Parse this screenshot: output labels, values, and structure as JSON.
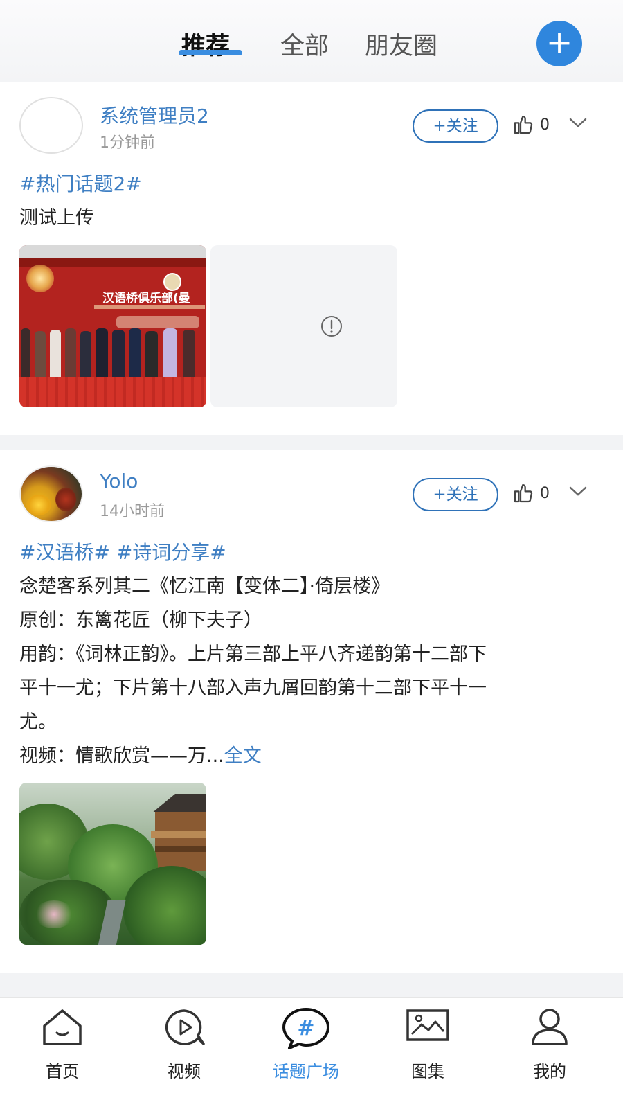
{
  "header": {
    "tabs": [
      {
        "label": "推荐",
        "active": true
      },
      {
        "label": "全部",
        "active": false
      },
      {
        "label": "朋友圈",
        "active": false
      }
    ],
    "add_label": "+"
  },
  "posts": [
    {
      "username": "系统管理员2",
      "time": "1分钟前",
      "follow_label": "+关注",
      "likes": "0",
      "topics": "#热门话题2#",
      "lines": [
        "测试上传"
      ],
      "images": [
        "stage-photo",
        "image-load-failed"
      ]
    },
    {
      "username": "Yolo",
      "time": "14小时前",
      "follow_label": "+关注",
      "likes": "0",
      "topics": "#汉语桥#  #诗词分享#",
      "lines": [
        "念楚客系列其二《忆江南【变体二】·倚层楼》",
        "原创：东篱花匠（柳下夫子）",
        "用韵：《词林正韵》。上片第三部上平八齐递韵第十二部下",
        "平十一尤；下片第十八部入声九屑回韵第十二部下平十一",
        "尤。"
      ],
      "last_line_prefix": "视频：情歌欣赏——万...",
      "more_label": "全文",
      "images": [
        "garden-house-photo"
      ]
    }
  ],
  "stage_banner_text": "汉语桥俱乐部(曼",
  "bottom_nav": [
    {
      "label": "首页",
      "icon": "home-icon",
      "active": false
    },
    {
      "label": "视频",
      "icon": "video-icon",
      "active": false
    },
    {
      "label": "话题广场",
      "icon": "topic-square-icon",
      "active": true
    },
    {
      "label": "图集",
      "icon": "gallery-icon",
      "active": false
    },
    {
      "label": "我的",
      "icon": "profile-icon",
      "active": false
    }
  ],
  "colors": {
    "accent": "#3a8de0",
    "link": "#3f7fc3",
    "follow_border": "#2f72b8"
  }
}
